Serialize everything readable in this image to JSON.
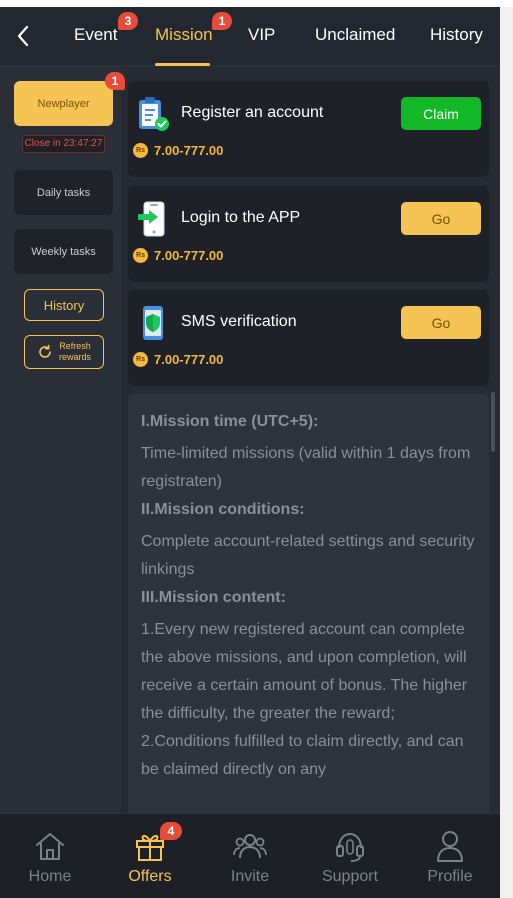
{
  "topbar": {
    "tabs": [
      {
        "label": "Event",
        "badge": "3"
      },
      {
        "label": "Mission",
        "badge": "1",
        "active": true
      },
      {
        "label": "VIP"
      },
      {
        "label": "Unclaimed"
      },
      {
        "label": "History"
      }
    ]
  },
  "sidebar": {
    "categories": [
      {
        "label": "Newplayer",
        "badge": "1",
        "timer": "Close in 23:47:27",
        "active": true
      },
      {
        "label": "Daily tasks"
      },
      {
        "label": "Weekly tasks"
      }
    ],
    "history_label": "History",
    "refresh_label_line1": "Refresh",
    "refresh_label_line2": "rewards"
  },
  "missions": [
    {
      "title": "Register an account",
      "reward": "7.00-777.00",
      "action": "Claim",
      "icon": "register-clipboard-icon"
    },
    {
      "title": "Login to the APP",
      "reward": "7.00-777.00",
      "action": "Go",
      "icon": "phone-login-icon"
    },
    {
      "title": "SMS verification",
      "reward": "7.00-777.00",
      "action": "Go",
      "icon": "phone-shield-icon"
    }
  ],
  "currency_symbol": "Rs",
  "description": {
    "h1": "I.Mission time (UTC+5):",
    "p1": "Time-limited missions (valid within 1 days from registraten)",
    "h2": "II.Mission conditions:",
    "p2": "Complete account-related settings and security linkings",
    "h3": "III.Mission content:",
    "p3": "1.Every new registered account can complete the above missions, and upon completion, will receive a certain amount of bonus. The higher the difficulty, the greater the reward;",
    "p4": "2.Conditions fulfilled to claim directly, and can be claimed directly on any"
  },
  "bottom_nav": {
    "items": [
      {
        "label": "Home",
        "icon": "home-icon"
      },
      {
        "label": "Offers",
        "icon": "gift-icon",
        "badge": "4",
        "active": true
      },
      {
        "label": "Invite",
        "icon": "users-icon"
      },
      {
        "label": "Support",
        "icon": "headset-icon"
      },
      {
        "label": "Profile",
        "icon": "profile-icon"
      }
    ]
  },
  "colors": {
    "accent": "#f5c454",
    "claim_green": "#12b826",
    "badge_red": "#e74b3c",
    "background": "#262a33"
  }
}
